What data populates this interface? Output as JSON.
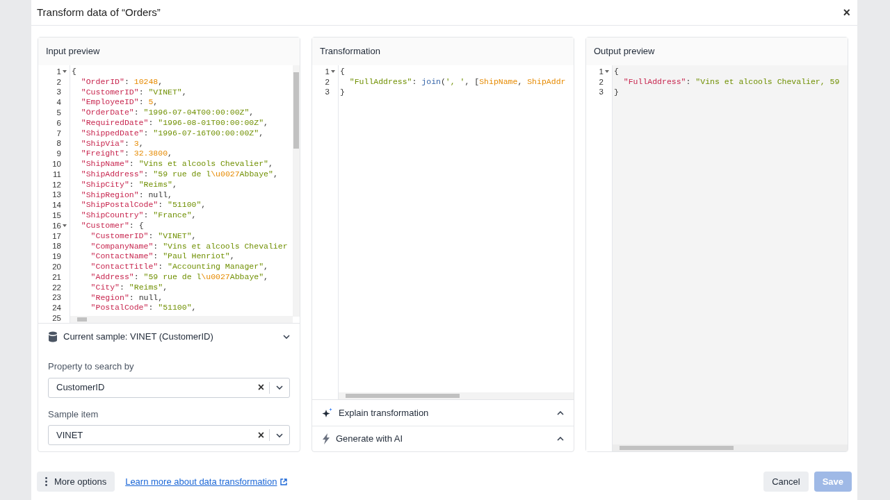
{
  "dialog": {
    "title": "Transform data of “Orders”",
    "close": "×"
  },
  "input_preview": {
    "title": "Input preview",
    "lines": [
      {
        "number": "1",
        "fold": true,
        "tokens": [
          {
            "kind": "punct",
            "text": "{"
          }
        ]
      },
      {
        "number": "2",
        "fold": false,
        "tokens": [
          {
            "kind": "key",
            "text": "  \"OrderID\""
          },
          {
            "kind": "punct",
            "text": ": "
          },
          {
            "kind": "number",
            "text": "10248"
          },
          {
            "kind": "punct",
            "text": ","
          }
        ]
      },
      {
        "number": "3",
        "fold": false,
        "tokens": [
          {
            "kind": "key",
            "text": "  \"CustomerID\""
          },
          {
            "kind": "punct",
            "text": ": "
          },
          {
            "kind": "string",
            "text": "\"VINET\""
          },
          {
            "kind": "punct",
            "text": ","
          }
        ]
      },
      {
        "number": "4",
        "fold": false,
        "tokens": [
          {
            "kind": "key",
            "text": "  \"EmployeeID\""
          },
          {
            "kind": "punct",
            "text": ": "
          },
          {
            "kind": "number",
            "text": "5"
          },
          {
            "kind": "punct",
            "text": ","
          }
        ]
      },
      {
        "number": "5",
        "fold": false,
        "tokens": [
          {
            "kind": "key",
            "text": "  \"OrderDate\""
          },
          {
            "kind": "punct",
            "text": ": "
          },
          {
            "kind": "string",
            "text": "\"1996-07-04T00:00:00Z\""
          },
          {
            "kind": "punct",
            "text": ","
          }
        ]
      },
      {
        "number": "6",
        "fold": false,
        "tokens": [
          {
            "kind": "key",
            "text": "  \"RequiredDate\""
          },
          {
            "kind": "punct",
            "text": ": "
          },
          {
            "kind": "string",
            "text": "\"1996-08-01T00:00:00Z\""
          },
          {
            "kind": "punct",
            "text": ","
          }
        ]
      },
      {
        "number": "7",
        "fold": false,
        "tokens": [
          {
            "kind": "key",
            "text": "  \"ShippedDate\""
          },
          {
            "kind": "punct",
            "text": ": "
          },
          {
            "kind": "string",
            "text": "\"1996-07-16T00:00:00Z\""
          },
          {
            "kind": "punct",
            "text": ","
          }
        ]
      },
      {
        "number": "8",
        "fold": false,
        "tokens": [
          {
            "kind": "key",
            "text": "  \"ShipVia\""
          },
          {
            "kind": "punct",
            "text": ": "
          },
          {
            "kind": "number",
            "text": "3"
          },
          {
            "kind": "punct",
            "text": ","
          }
        ]
      },
      {
        "number": "9",
        "fold": false,
        "tokens": [
          {
            "kind": "key",
            "text": "  \"Freight\""
          },
          {
            "kind": "punct",
            "text": ": "
          },
          {
            "kind": "number",
            "text": "32.3800"
          },
          {
            "kind": "punct",
            "text": ","
          }
        ]
      },
      {
        "number": "10",
        "fold": false,
        "tokens": [
          {
            "kind": "key",
            "text": "  \"ShipName\""
          },
          {
            "kind": "punct",
            "text": ": "
          },
          {
            "kind": "string",
            "text": "\"Vins et alcools Chevalier\""
          },
          {
            "kind": "punct",
            "text": ","
          }
        ]
      },
      {
        "number": "11",
        "fold": false,
        "tokens": [
          {
            "kind": "key",
            "text": "  \"ShipAddress\""
          },
          {
            "kind": "punct",
            "text": ": "
          },
          {
            "kind": "string",
            "text": "\"59 rue de l"
          },
          {
            "kind": "escape",
            "text": "\\u0027"
          },
          {
            "kind": "string",
            "text": "Abbaye\""
          },
          {
            "kind": "punct",
            "text": ","
          }
        ]
      },
      {
        "number": "12",
        "fold": false,
        "tokens": [
          {
            "kind": "key",
            "text": "  \"ShipCity\""
          },
          {
            "kind": "punct",
            "text": ": "
          },
          {
            "kind": "string",
            "text": "\"Reims\""
          },
          {
            "kind": "punct",
            "text": ","
          }
        ]
      },
      {
        "number": "13",
        "fold": false,
        "tokens": [
          {
            "kind": "key",
            "text": "  \"ShipRegion\""
          },
          {
            "kind": "punct",
            "text": ": "
          },
          {
            "kind": "null",
            "text": "null"
          },
          {
            "kind": "punct",
            "text": ","
          }
        ]
      },
      {
        "number": "14",
        "fold": false,
        "tokens": [
          {
            "kind": "key",
            "text": "  \"ShipPostalCode\""
          },
          {
            "kind": "punct",
            "text": ": "
          },
          {
            "kind": "string",
            "text": "\"51100\""
          },
          {
            "kind": "punct",
            "text": ","
          }
        ]
      },
      {
        "number": "15",
        "fold": false,
        "tokens": [
          {
            "kind": "key",
            "text": "  \"ShipCountry\""
          },
          {
            "kind": "punct",
            "text": ": "
          },
          {
            "kind": "string",
            "text": "\"France\""
          },
          {
            "kind": "punct",
            "text": ","
          }
        ]
      },
      {
        "number": "16",
        "fold": true,
        "tokens": [
          {
            "kind": "key",
            "text": "  \"Customer\""
          },
          {
            "kind": "punct",
            "text": ": {"
          }
        ]
      },
      {
        "number": "17",
        "fold": false,
        "tokens": [
          {
            "kind": "key",
            "text": "    \"CustomerID\""
          },
          {
            "kind": "punct",
            "text": ": "
          },
          {
            "kind": "string",
            "text": "\"VINET\""
          },
          {
            "kind": "punct",
            "text": ","
          }
        ]
      },
      {
        "number": "18",
        "fold": false,
        "tokens": [
          {
            "kind": "key",
            "text": "    \"CompanyName\""
          },
          {
            "kind": "punct",
            "text": ": "
          },
          {
            "kind": "string",
            "text": "\"Vins et alcools Chevalier"
          }
        ]
      },
      {
        "number": "19",
        "fold": false,
        "tokens": [
          {
            "kind": "key",
            "text": "    \"ContactName\""
          },
          {
            "kind": "punct",
            "text": ": "
          },
          {
            "kind": "string",
            "text": "\"Paul Henriot\""
          },
          {
            "kind": "punct",
            "text": ","
          }
        ]
      },
      {
        "number": "20",
        "fold": false,
        "tokens": [
          {
            "kind": "key",
            "text": "    \"ContactTitle\""
          },
          {
            "kind": "punct",
            "text": ": "
          },
          {
            "kind": "string",
            "text": "\"Accounting Manager\""
          },
          {
            "kind": "punct",
            "text": ","
          }
        ]
      },
      {
        "number": "21",
        "fold": false,
        "tokens": [
          {
            "kind": "key",
            "text": "    \"Address\""
          },
          {
            "kind": "punct",
            "text": ": "
          },
          {
            "kind": "string",
            "text": "\"59 rue de l"
          },
          {
            "kind": "escape",
            "text": "\\u0027"
          },
          {
            "kind": "string",
            "text": "Abbaye\""
          },
          {
            "kind": "punct",
            "text": ","
          }
        ]
      },
      {
        "number": "22",
        "fold": false,
        "tokens": [
          {
            "kind": "key",
            "text": "    \"City\""
          },
          {
            "kind": "punct",
            "text": ": "
          },
          {
            "kind": "string",
            "text": "\"Reims\""
          },
          {
            "kind": "punct",
            "text": ","
          }
        ]
      },
      {
        "number": "23",
        "fold": false,
        "tokens": [
          {
            "kind": "key",
            "text": "    \"Region\""
          },
          {
            "kind": "punct",
            "text": ": "
          },
          {
            "kind": "null",
            "text": "null"
          },
          {
            "kind": "punct",
            "text": ","
          }
        ]
      },
      {
        "number": "24",
        "fold": false,
        "tokens": [
          {
            "kind": "key",
            "text": "    \"PostalCode\""
          },
          {
            "kind": "punct",
            "text": ": "
          },
          {
            "kind": "string",
            "text": "\"51100\""
          },
          {
            "kind": "punct",
            "text": ","
          }
        ]
      },
      {
        "number": "25",
        "fold": false
      }
    ],
    "sample": {
      "label": "Current sample: VINET (CustomerID)",
      "expanded": true,
      "fields": [
        {
          "label": "Property to search by",
          "value": "CustomerID",
          "clear": "×"
        },
        {
          "label": "Sample item",
          "value": "VINET",
          "clear": "×"
        }
      ]
    }
  },
  "transformation": {
    "title": "Transformation",
    "lines": [
      {
        "number": "1",
        "fold": true,
        "tokens": [
          {
            "kind": "punct",
            "text": "{"
          }
        ]
      },
      {
        "number": "2",
        "fold": false,
        "tokens": [
          {
            "kind": "string",
            "text": "  \"FullAddress\""
          },
          {
            "kind": "punct",
            "text": ": "
          },
          {
            "kind": "function",
            "text": "join"
          },
          {
            "kind": "punct",
            "text": "("
          },
          {
            "kind": "string",
            "text": "', '"
          },
          {
            "kind": "punct",
            "text": ", ["
          },
          {
            "kind": "variable",
            "text": "ShipName"
          },
          {
            "kind": "punct",
            "text": ", "
          },
          {
            "kind": "variable",
            "text": "ShipAddr"
          }
        ]
      },
      {
        "number": "3",
        "fold": false,
        "tokens": [
          {
            "kind": "punct",
            "text": "}"
          }
        ]
      }
    ],
    "sections": [
      {
        "label": "Explain transformation",
        "expanded": false
      },
      {
        "label": "Generate with AI",
        "expanded": false
      }
    ]
  },
  "output_preview": {
    "title": "Output preview",
    "lines": [
      {
        "number": "1",
        "fold": true,
        "tokens": [
          {
            "kind": "punct",
            "text": "{"
          }
        ]
      },
      {
        "number": "2",
        "fold": false,
        "tokens": [
          {
            "kind": "key",
            "text": "  \"FullAddress\""
          },
          {
            "kind": "punct",
            "text": ": "
          },
          {
            "kind": "string",
            "text": "\"Vins et alcools Chevalier, 59"
          }
        ]
      },
      {
        "number": "3",
        "fold": false,
        "tokens": [
          {
            "kind": "punct",
            "text": "}"
          }
        ]
      }
    ]
  },
  "footer": {
    "more_options": "More options",
    "learn_more": "Learn more about data transformation",
    "cancel": "Cancel",
    "save": {
      "label": "Save",
      "disabled": true
    }
  }
}
